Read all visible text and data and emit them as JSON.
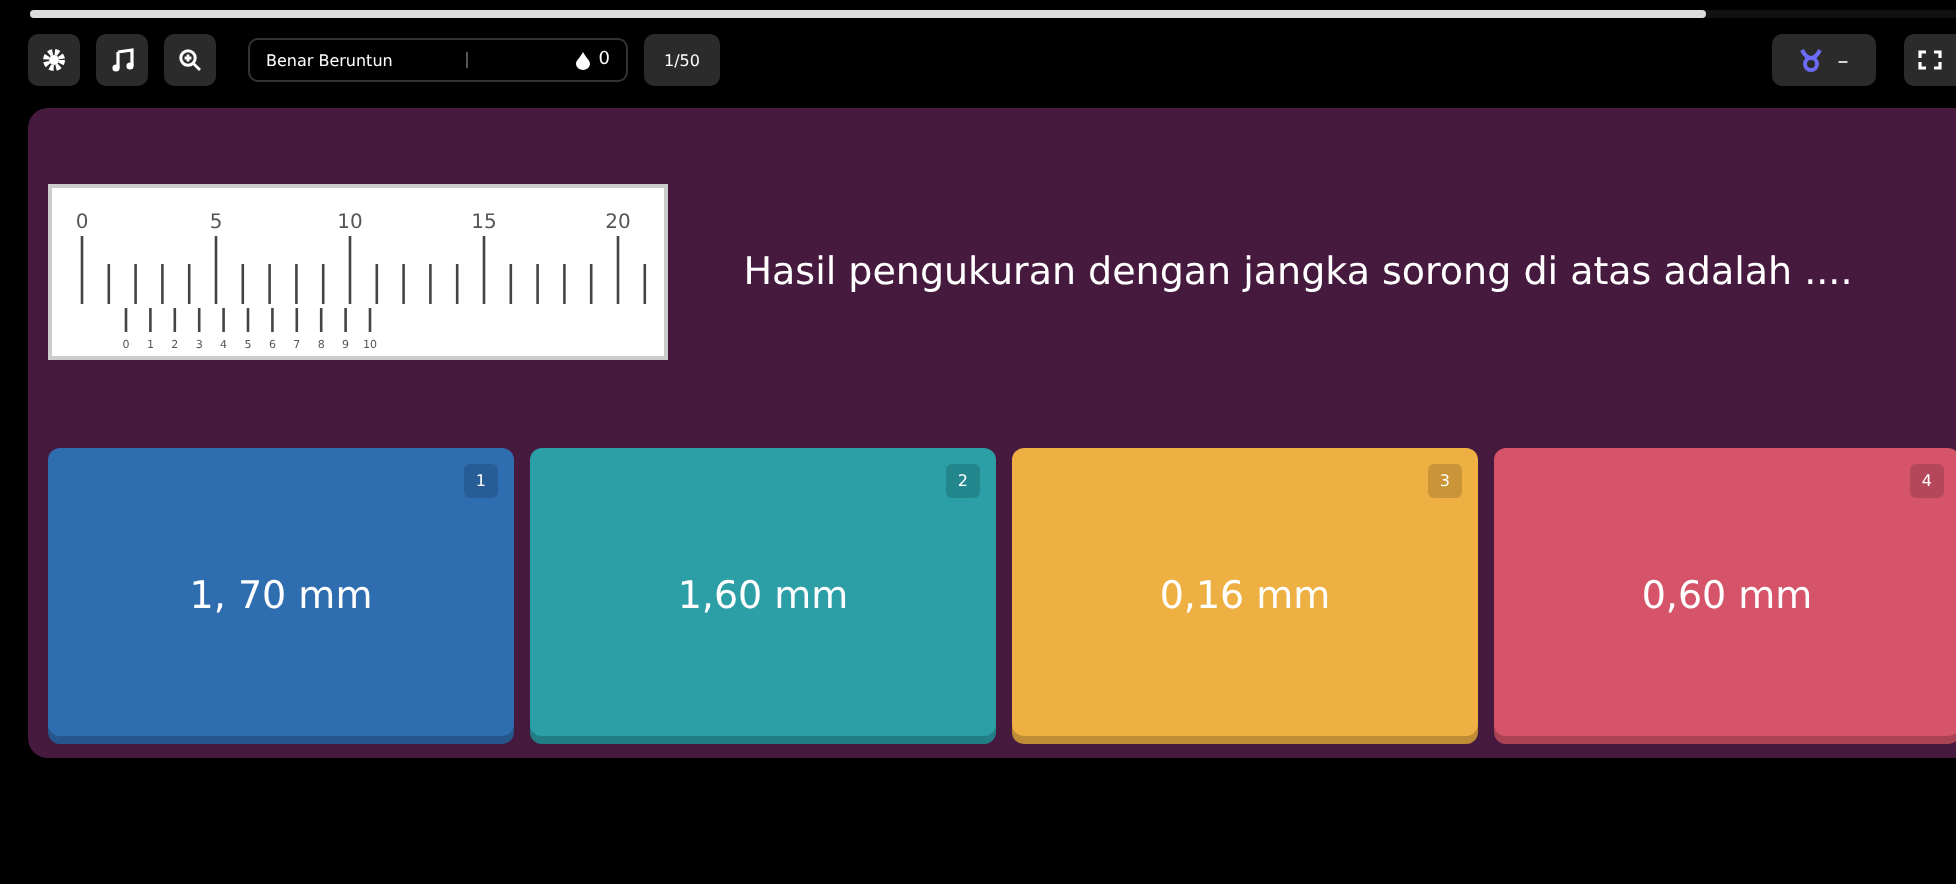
{
  "progress": {
    "level": 0.87
  },
  "toolbar": {
    "streak_label": "Benar Beruntun",
    "streak_count": "0",
    "question_counter": "1/50",
    "power_up": "–"
  },
  "question": {
    "text": "Hasil pengukuran dengan jangka sorong di atas adalah ....",
    "ruler": {
      "main_labels": [
        "0",
        "5",
        "10",
        "15",
        "20"
      ],
      "vernier_labels": [
        "0",
        "1",
        "2",
        "3",
        "4",
        "5",
        "6",
        "7",
        "8",
        "9",
        "10"
      ]
    }
  },
  "answers": [
    {
      "number": "1",
      "text": "1, 70 mm",
      "color": "#2f6db1"
    },
    {
      "number": "2",
      "text": "1,60 mm",
      "color": "#2b9ea6"
    },
    {
      "number": "3",
      "text": "0,16 mm",
      "color": "#eeb042"
    },
    {
      "number": "4",
      "text": "0,60 mm",
      "color": "#d5546a"
    }
  ]
}
